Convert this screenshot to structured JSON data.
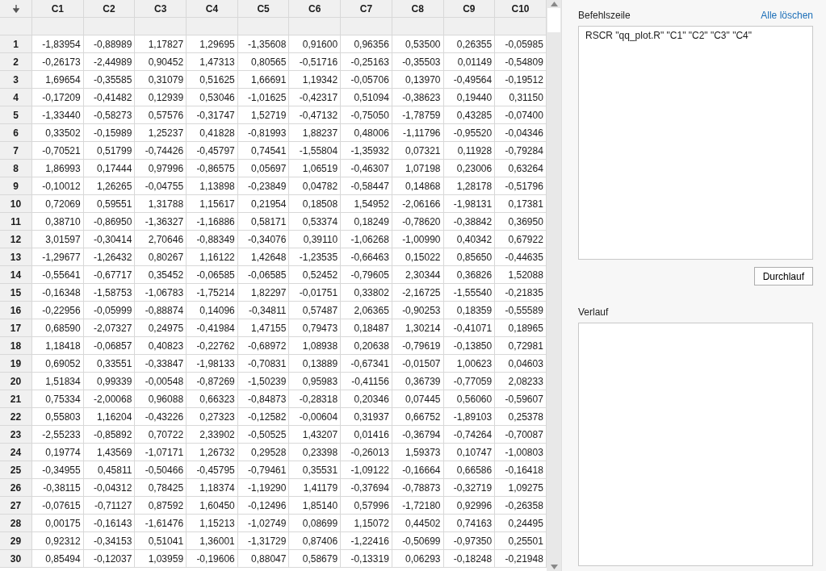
{
  "table": {
    "columns": [
      "C1",
      "C2",
      "C3",
      "C4",
      "C5",
      "C6",
      "C7",
      "C8",
      "C9",
      "C10"
    ],
    "rows": [
      {
        "label": "1",
        "cells": [
          "-1,83954",
          "-0,88989",
          "1,17827",
          "1,29695",
          "-1,35608",
          "0,91600",
          "0,96356",
          "0,53500",
          "0,26355",
          "-0,05985"
        ]
      },
      {
        "label": "2",
        "cells": [
          "-0,26173",
          "-2,44989",
          "0,90452",
          "1,47313",
          "0,80565",
          "-0,51716",
          "-0,25163",
          "-0,35503",
          "0,01149",
          "-0,54809"
        ]
      },
      {
        "label": "3",
        "cells": [
          "1,69654",
          "-0,35585",
          "0,31079",
          "0,51625",
          "1,66691",
          "1,19342",
          "-0,05706",
          "0,13970",
          "-0,49564",
          "-0,19512"
        ]
      },
      {
        "label": "4",
        "cells": [
          "-0,17209",
          "-0,41482",
          "0,12939",
          "0,53046",
          "-1,01625",
          "-0,42317",
          "0,51094",
          "-0,38623",
          "0,19440",
          "0,31150"
        ]
      },
      {
        "label": "5",
        "cells": [
          "-1,33440",
          "-0,58273",
          "0,57576",
          "-0,31747",
          "1,52719",
          "-0,47132",
          "-0,75050",
          "-1,78759",
          "0,43285",
          "-0,07400"
        ]
      },
      {
        "label": "6",
        "cells": [
          "0,33502",
          "-0,15989",
          "1,25237",
          "0,41828",
          "-0,81993",
          "1,88237",
          "0,48006",
          "-1,11796",
          "-0,95520",
          "-0,04346"
        ]
      },
      {
        "label": "7",
        "cells": [
          "-0,70521",
          "0,51799",
          "-0,74426",
          "-0,45797",
          "0,74541",
          "-1,55804",
          "-1,35932",
          "0,07321",
          "0,11928",
          "-0,79284"
        ]
      },
      {
        "label": "8",
        "cells": [
          "1,86993",
          "0,17444",
          "0,97996",
          "-0,86575",
          "0,05697",
          "1,06519",
          "-0,46307",
          "1,07198",
          "0,23006",
          "0,63264"
        ]
      },
      {
        "label": "9",
        "cells": [
          "-0,10012",
          "1,26265",
          "-0,04755",
          "1,13898",
          "-0,23849",
          "0,04782",
          "-0,58447",
          "0,14868",
          "1,28178",
          "-0,51796"
        ]
      },
      {
        "label": "10",
        "cells": [
          "0,72069",
          "0,59551",
          "1,31788",
          "1,15617",
          "0,21954",
          "0,18508",
          "1,54952",
          "-2,06166",
          "-1,98131",
          "0,17381"
        ]
      },
      {
        "label": "11",
        "cells": [
          "0,38710",
          "-0,86950",
          "-1,36327",
          "-1,16886",
          "0,58171",
          "0,53374",
          "0,18249",
          "-0,78620",
          "-0,38842",
          "0,36950"
        ]
      },
      {
        "label": "12",
        "cells": [
          "3,01597",
          "-0,30414",
          "2,70646",
          "-0,88349",
          "-0,34076",
          "0,39110",
          "-1,06268",
          "-1,00990",
          "0,40342",
          "0,67922"
        ]
      },
      {
        "label": "13",
        "cells": [
          "-1,29677",
          "-1,26432",
          "0,80267",
          "1,16122",
          "1,42648",
          "-1,23535",
          "-0,66463",
          "0,15022",
          "0,85650",
          "-0,44635"
        ]
      },
      {
        "label": "14",
        "cells": [
          "-0,55641",
          "-0,67717",
          "0,35452",
          "-0,06585",
          "-0,06585",
          "0,52452",
          "-0,79605",
          "2,30344",
          "0,36826",
          "1,52088"
        ]
      },
      {
        "label": "15",
        "cells": [
          "-0,16348",
          "-1,58753",
          "-1,06783",
          "-1,75214",
          "1,82297",
          "-0,01751",
          "0,33802",
          "-2,16725",
          "-1,55540",
          "-0,21835"
        ]
      },
      {
        "label": "16",
        "cells": [
          "-0,22956",
          "-0,05999",
          "-0,88874",
          "0,14096",
          "-0,34811",
          "0,57487",
          "2,06365",
          "-0,90253",
          "0,18359",
          "-0,55589"
        ]
      },
      {
        "label": "17",
        "cells": [
          "0,68590",
          "-2,07327",
          "0,24975",
          "-0,41984",
          "1,47155",
          "0,79473",
          "0,18487",
          "1,30214",
          "-0,41071",
          "0,18965"
        ]
      },
      {
        "label": "18",
        "cells": [
          "1,18418",
          "-0,06857",
          "0,40823",
          "-0,22762",
          "-0,68972",
          "1,08938",
          "0,20638",
          "-0,79619",
          "-0,13850",
          "0,72981"
        ]
      },
      {
        "label": "19",
        "cells": [
          "0,69052",
          "0,33551",
          "-0,33847",
          "-1,98133",
          "-0,70831",
          "0,13889",
          "-0,67341",
          "-0,01507",
          "1,00623",
          "0,04603"
        ]
      },
      {
        "label": "20",
        "cells": [
          "1,51834",
          "0,99339",
          "-0,00548",
          "-0,87269",
          "-1,50239",
          "0,95983",
          "-0,41156",
          "0,36739",
          "-0,77059",
          "2,08233"
        ]
      },
      {
        "label": "21",
        "cells": [
          "0,75334",
          "-2,00068",
          "0,96088",
          "0,66323",
          "-0,84873",
          "-0,28318",
          "0,20346",
          "0,07445",
          "0,56060",
          "-0,59607"
        ]
      },
      {
        "label": "22",
        "cells": [
          "0,55803",
          "1,16204",
          "-0,43226",
          "0,27323",
          "-0,12582",
          "-0,00604",
          "0,31937",
          "0,66752",
          "-1,89103",
          "0,25378"
        ]
      },
      {
        "label": "23",
        "cells": [
          "-2,55233",
          "-0,85892",
          "0,70722",
          "2,33902",
          "-0,50525",
          "1,43207",
          "0,01416",
          "-0,36794",
          "-0,74264",
          "-0,70087"
        ]
      },
      {
        "label": "24",
        "cells": [
          "0,19774",
          "1,43569",
          "-1,07171",
          "1,26732",
          "0,29528",
          "0,23398",
          "-0,26013",
          "1,59373",
          "0,10747",
          "-1,00803"
        ]
      },
      {
        "label": "25",
        "cells": [
          "-0,34955",
          "0,45811",
          "-0,50466",
          "-0,45795",
          "-0,79461",
          "0,35531",
          "-1,09122",
          "-0,16664",
          "0,66586",
          "-0,16418"
        ]
      },
      {
        "label": "26",
        "cells": [
          "-0,38115",
          "-0,04312",
          "0,78425",
          "1,18374",
          "-1,19290",
          "1,41179",
          "-0,37694",
          "-0,78873",
          "-0,32719",
          "1,09275"
        ]
      },
      {
        "label": "27",
        "cells": [
          "-0,07615",
          "-0,71127",
          "0,87592",
          "1,60450",
          "-0,12496",
          "1,85140",
          "0,57996",
          "-1,72180",
          "0,92996",
          "-0,26358"
        ]
      },
      {
        "label": "28",
        "cells": [
          "0,00175",
          "-0,16143",
          "-1,61476",
          "1,15213",
          "-1,02749",
          "0,08699",
          "1,15072",
          "0,44502",
          "0,74163",
          "0,24495"
        ]
      },
      {
        "label": "29",
        "cells": [
          "0,92312",
          "-0,34153",
          "0,51041",
          "1,36001",
          "-1,31729",
          "0,87406",
          "-1,22416",
          "-0,50699",
          "-0,97350",
          "0,25501"
        ]
      },
      {
        "label": "30",
        "cells": [
          "0,85494",
          "-0,12037",
          "1,03959",
          "-0,19606",
          "0,88047",
          "0,58679",
          "-0,13319",
          "0,06293",
          "-0,18248",
          "-0,21948"
        ]
      }
    ]
  },
  "command_panel": {
    "title": "Befehlszeile",
    "clear_link": "Alle löschen",
    "command": "RSCR \"qq_plot.R\" \"C1\" \"C2\" \"C3\" \"C4\"",
    "run_button": "Durchlauf",
    "history_title": "Verlauf"
  }
}
